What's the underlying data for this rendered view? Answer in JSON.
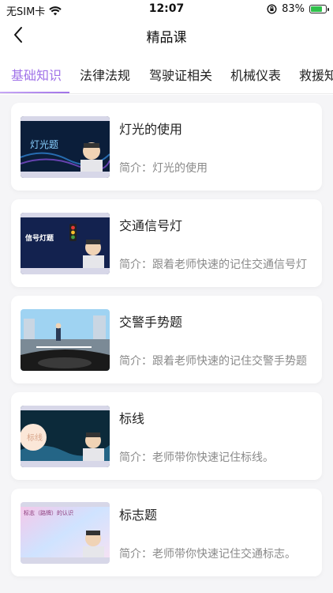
{
  "status_bar": {
    "carrier": "无SIM卡",
    "time": "12:07",
    "battery": "83%",
    "battery_level": 0.83
  },
  "nav": {
    "title": "精品课"
  },
  "tabs": [
    {
      "label": "基础知识",
      "active": true
    },
    {
      "label": "法律法规",
      "active": false
    },
    {
      "label": "驾驶证相关",
      "active": false
    },
    {
      "label": "机械仪表",
      "active": false
    },
    {
      "label": "救援知",
      "active": false
    }
  ],
  "colors": {
    "accent": "#a072e8",
    "background": "#f5f5f7",
    "card": "#ffffff",
    "desc_text": "#8a8a8a"
  },
  "courses": [
    {
      "title": "灯光的使用",
      "desc_prefix": "简介：",
      "desc": "灯光的使用",
      "thumb_text": "灯光题",
      "thumb_theme": "dark-blue"
    },
    {
      "title": "交通信号灯",
      "desc_prefix": "简介：",
      "desc": "跟着老师快速的记住交通信号灯",
      "thumb_text": "信号灯题",
      "thumb_theme": "navy-lights"
    },
    {
      "title": "交警手势题",
      "desc_prefix": "简介：",
      "desc": "跟着老师快速的记住交警手势题",
      "thumb_text": "",
      "thumb_theme": "street-scene"
    },
    {
      "title": "标线",
      "desc_prefix": "简介：",
      "desc": "老师带你快速记住标线。",
      "thumb_text": "标线",
      "thumb_theme": "teal-wave"
    },
    {
      "title": "标志题",
      "desc_prefix": "简介：",
      "desc": "老师带你快速记住交通标志。",
      "thumb_text": "标志（路牌）的认识",
      "thumb_theme": "pastel"
    }
  ]
}
